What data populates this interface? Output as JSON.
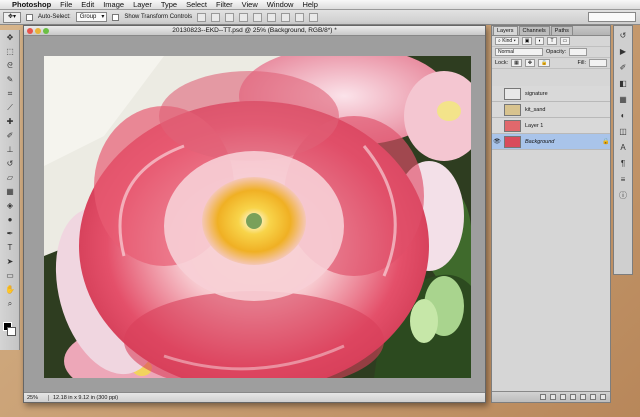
{
  "menubar": {
    "apple": "",
    "items": [
      "Photoshop",
      "File",
      "Edit",
      "Image",
      "Layer",
      "Type",
      "Select",
      "Filter",
      "View",
      "Window",
      "Help"
    ]
  },
  "options_bar": {
    "auto_select_label": "Auto-Select:",
    "auto_select_value": "Group",
    "transform_label": "Show Transform Controls"
  },
  "document": {
    "title": "20130823--EKD--TT.psd @ 25% (Background, RGB/8*) *",
    "zoom": "25%",
    "info": "12.18 in x 9.12 in (300 ppi)"
  },
  "panels": {
    "tabs": [
      "Layers",
      "Channels",
      "Paths"
    ],
    "kind_label": "Kind",
    "blend_mode": "Normal",
    "opacity_label": "Opacity:",
    "lock_label": "Lock:",
    "fill_label": "Fill:",
    "layers": [
      {
        "name": "signature",
        "visible": false,
        "selected": false,
        "thumb": "#e8e8e8"
      },
      {
        "name": "kit_sand",
        "visible": false,
        "selected": false,
        "thumb": "#d8c38e"
      },
      {
        "name": "Layer 1",
        "visible": false,
        "selected": false,
        "thumb": "#e0686c"
      },
      {
        "name": "Background",
        "visible": true,
        "selected": true,
        "thumb": "#d94b5c"
      }
    ]
  },
  "colors": {
    "menubar": "#e8e8e8",
    "panel_bg": "#d6d6d6",
    "selected_layer": "#a9c4ea",
    "canvas_frame": "#9e9e9e"
  }
}
